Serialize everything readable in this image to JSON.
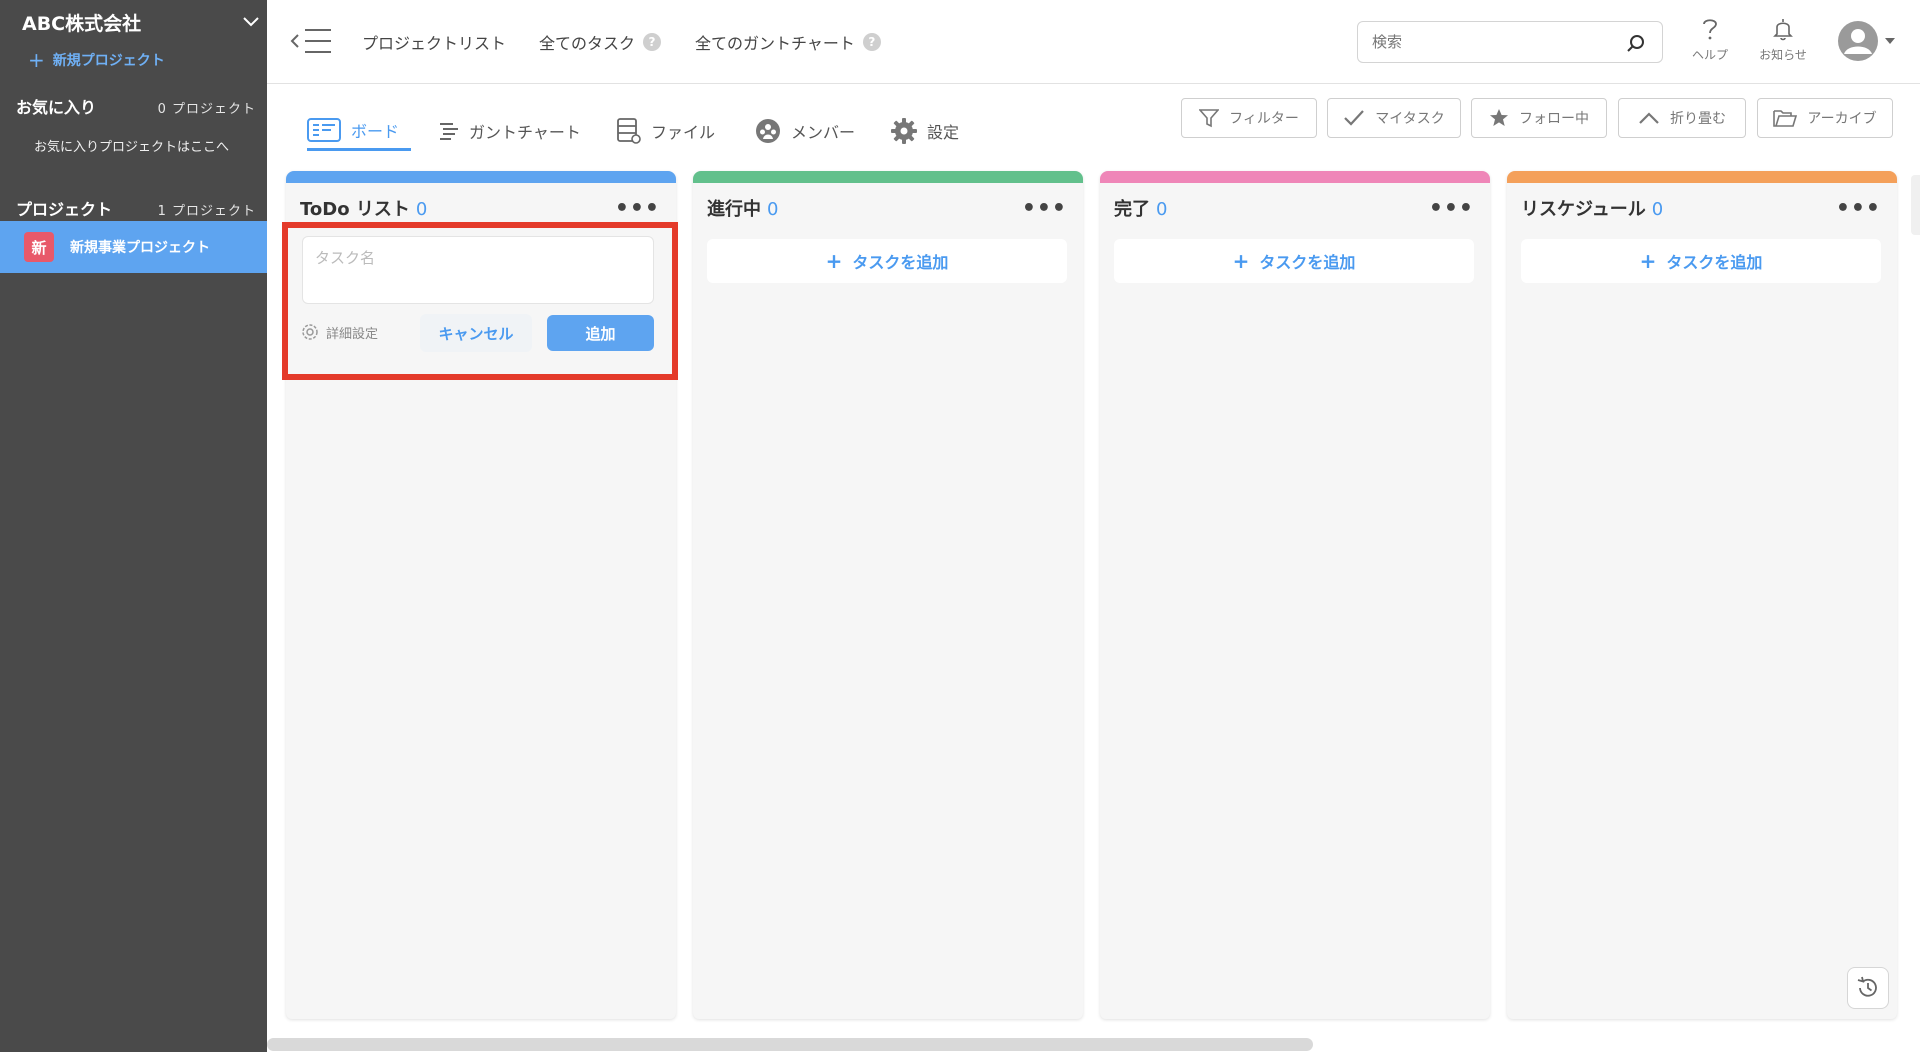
{
  "sidebar": {
    "company": "ABC株式会社",
    "new_project": "新規プロジェクト",
    "favorites_title": "お気に入り",
    "favorites_count": "0 プロジェクト",
    "favorites_note": "お気に入りプロジェクトはここへ",
    "projects_title": "プロジェクト",
    "projects_count": "1 プロジェクト",
    "projects": [
      {
        "badge": "新",
        "name": "新規事業プロジェクト",
        "badge_color": "#e8596a"
      }
    ],
    "active_color": "#5ea4f0"
  },
  "topbar": {
    "links": [
      "プロジェクトリスト",
      "全てのタスク",
      "全てのガントチャート"
    ],
    "help_mark": "?",
    "search_placeholder": "検索",
    "search_value": "",
    "help_label": "ヘルプ",
    "notify_label": "お知らせ"
  },
  "tabs": {
    "items": [
      {
        "label": "ボード",
        "icon": "board-icon",
        "active": true
      },
      {
        "label": "ガントチャート",
        "icon": "gantt-icon"
      },
      {
        "label": "ファイル",
        "icon": "file-icon"
      },
      {
        "label": "メンバー",
        "icon": "members-icon"
      },
      {
        "label": "設定",
        "icon": "gear-icon"
      }
    ],
    "tools": [
      {
        "label": "フィルター",
        "icon": "filter-icon"
      },
      {
        "label": "マイタスク",
        "icon": "check-icon"
      },
      {
        "label": "フォロー中",
        "icon": "star-icon"
      },
      {
        "label": "折り畳む",
        "icon": "chevron-up-icon"
      },
      {
        "label": "アーカイブ",
        "icon": "folder-icon"
      }
    ]
  },
  "board": {
    "columns": [
      {
        "title": "ToDo リスト",
        "count": "0",
        "color": "#5ea4f0"
      },
      {
        "title": "進行中",
        "count": "0",
        "color": "#62c08c"
      },
      {
        "title": "完了",
        "count": "0",
        "color": "#ef86b8"
      },
      {
        "title": "リスケジュール",
        "count": "0",
        "color": "#f4a05a"
      }
    ],
    "more": "•••",
    "add_task": "タスクを追加",
    "new_task": {
      "placeholder": "タスク名",
      "value": "",
      "detail": "詳細設定",
      "cancel": "キャンセル",
      "submit": "追加"
    }
  },
  "colors": {
    "accent": "#4a9af0",
    "highlight": "#e43a2a",
    "sidebar": "#4a4a4a"
  }
}
